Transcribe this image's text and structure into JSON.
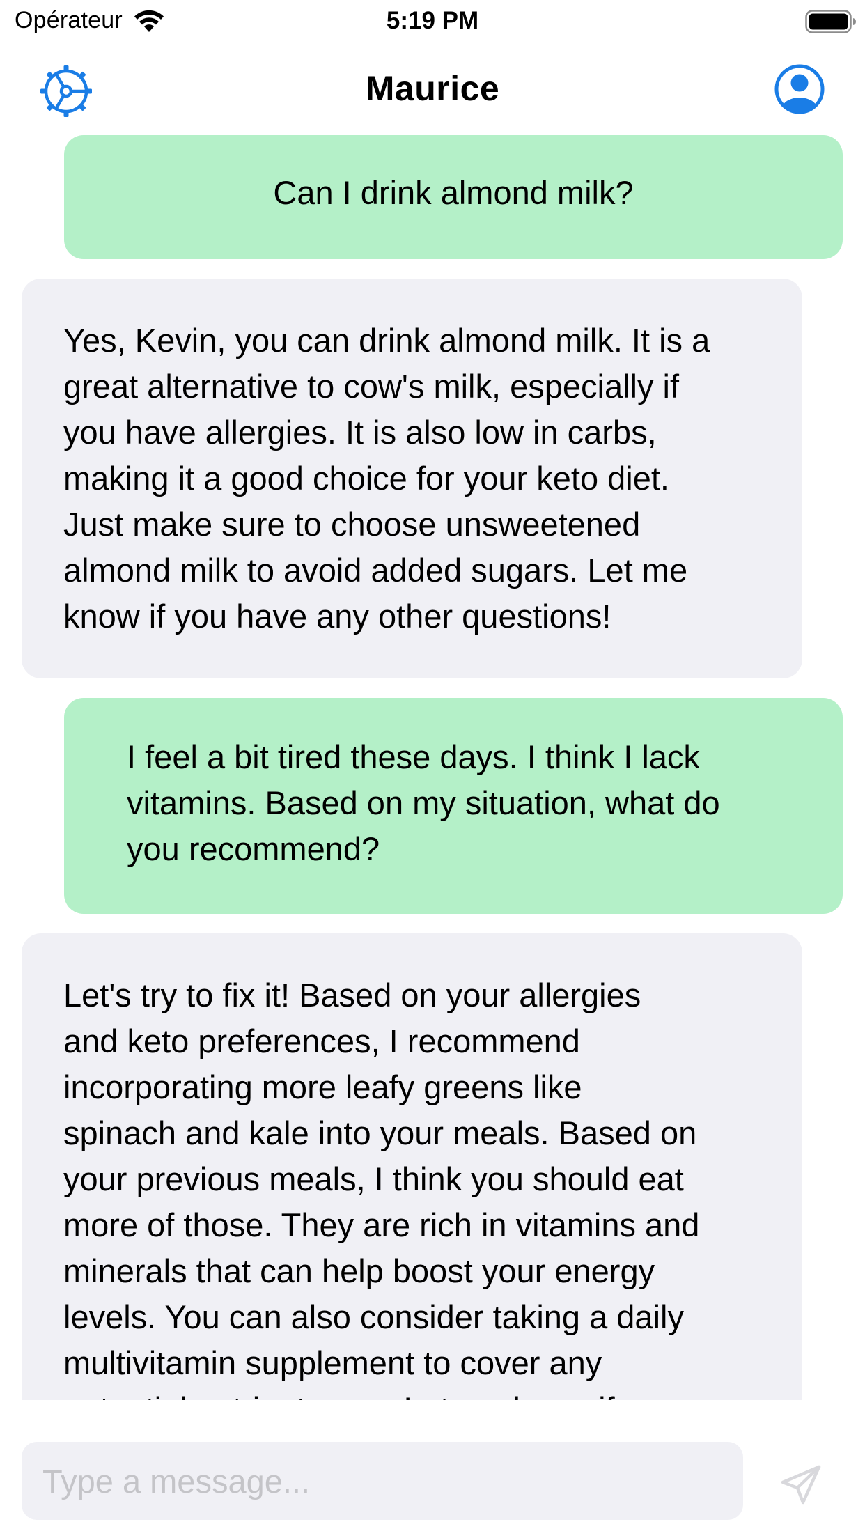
{
  "status_bar": {
    "carrier": "Opérateur",
    "time": "5:19 PM",
    "icons": [
      "wifi-icon",
      "battery-icon"
    ]
  },
  "nav": {
    "title": "Maurice",
    "left_icon": "settings-gear-icon",
    "right_icon": "person-circle-icon"
  },
  "messages": [
    {
      "role": "user",
      "text": "Can I drink almond milk?"
    },
    {
      "role": "assistant",
      "lines": [
        "Yes, Kevin, you can drink almond milk. It is a",
        "great alternative to cow's milk, especially if",
        "you have allergies. It is also low in carbs,",
        "making it a good choice for your keto diet.",
        "Just make sure to choose unsweetened",
        "almond milk to avoid added sugars. Let me",
        "know if you have any other questions!"
      ]
    },
    {
      "role": "user",
      "lines": [
        "I feel a bit tired these days. I think I lack",
        "vitamins. Based on my situation, what do",
        "you recommend?"
      ]
    },
    {
      "role": "assistant",
      "lines": [
        "Let's try to fix it! Based on your allergies",
        "and keto preferences, I recommend",
        "incorporating more leafy greens like",
        "spinach and kale into your meals. Based on",
        "your previous meals, I think you should eat",
        "more of those. They are rich in vitamins and",
        "minerals that can help boost your energy",
        "levels. You can also consider taking a daily",
        "multivitamin supplement to cover any",
        "potential nutrient gaps. Let me know if"
      ]
    }
  ],
  "composer": {
    "placeholder": "Type a message...",
    "value": "",
    "send_icon": "send-paper-plane-icon"
  },
  "colors": {
    "accent": "#1a7de6",
    "user_bubble": "#b4f0c8",
    "assistant_bubble": "#f0f0f5",
    "placeholder": "#c4c4c8",
    "send_disabled": "#d8d8dc"
  }
}
